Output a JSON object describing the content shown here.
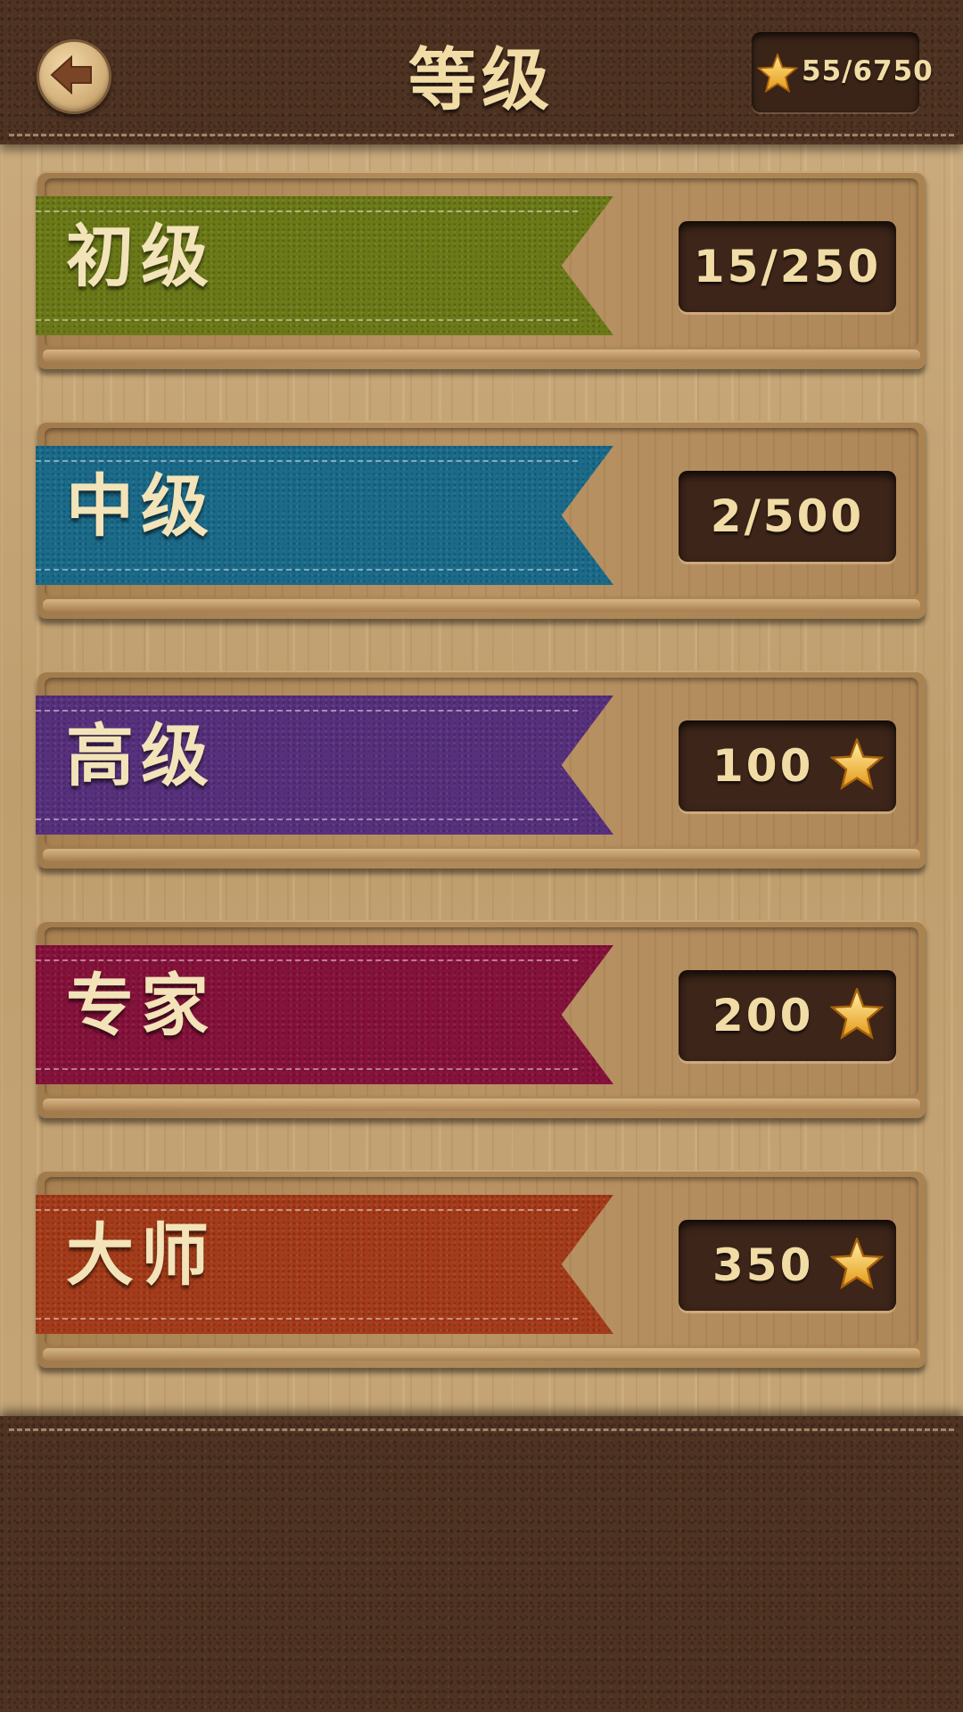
{
  "header": {
    "title": "等级",
    "star_total": "55/6750"
  },
  "colors": {
    "leather": "#4e3222",
    "wood": "#c7a678",
    "text_cream": "#f1dca6",
    "star_gold": "#f6c232"
  },
  "levels": [
    {
      "label": "初级",
      "score": "15/250",
      "star": false,
      "color": "#6b7a17"
    },
    {
      "label": "中级",
      "score": "2/500",
      "star": false,
      "color": "#1a6a8a"
    },
    {
      "label": "高级",
      "score": "100",
      "star": true,
      "color": "#57307d"
    },
    {
      "label": "专家",
      "score": "200",
      "star": true,
      "color": "#86113a"
    },
    {
      "label": "大师",
      "score": "350",
      "star": true,
      "color": "#a53b19"
    }
  ],
  "icons": {
    "back": "arrow-left-icon",
    "star": "star-icon"
  }
}
